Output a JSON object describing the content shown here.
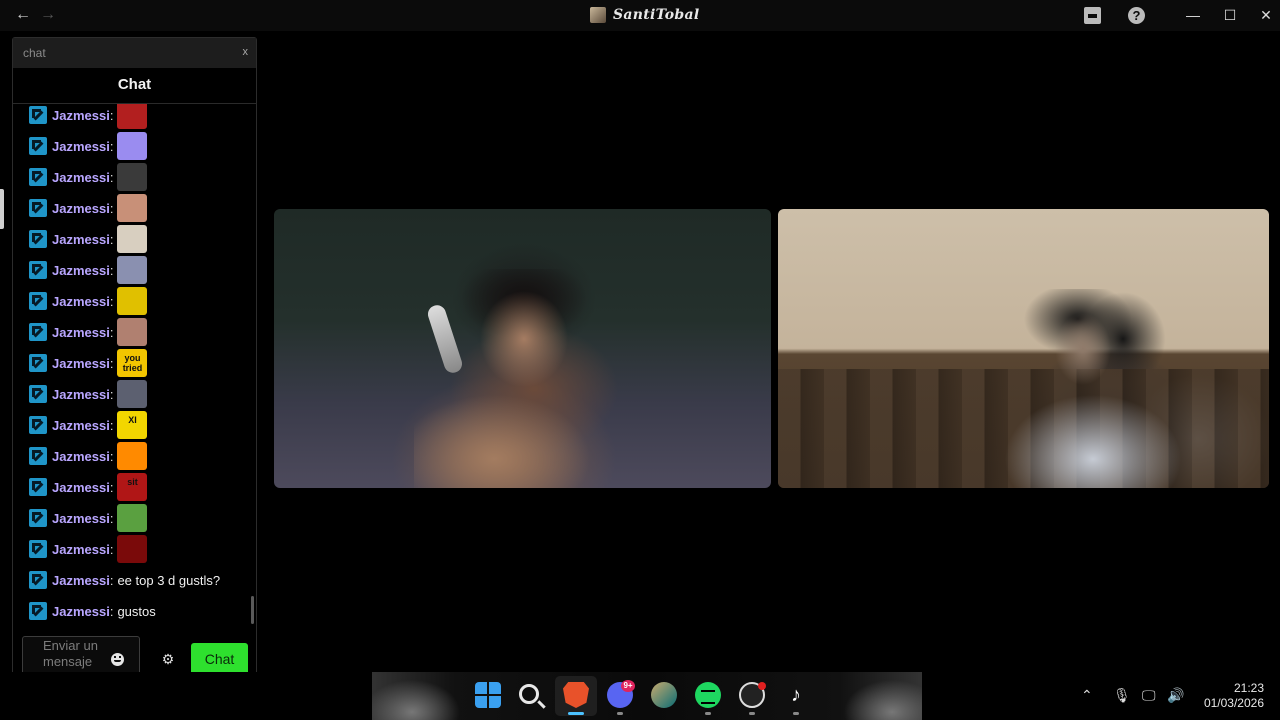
{
  "window": {
    "title": "SantiTobal",
    "back_icon": "arrow-left-icon",
    "forward_icon": "arrow-right-icon",
    "minimize": "—",
    "maximize": "☐",
    "close": "✕"
  },
  "chat": {
    "top_label": "chat",
    "close_label": "x",
    "header": "Chat",
    "messages": [
      {
        "user": "Jazmessi",
        "text": "",
        "emote_color": "#b21f1f"
      },
      {
        "user": "Jazmessi",
        "text": "",
        "emote_color": "#9a8cf0"
      },
      {
        "user": "Jazmessi",
        "text": "",
        "emote_color": "#3a3a3a"
      },
      {
        "user": "Jazmessi",
        "text": "",
        "emote_color": "#c89078"
      },
      {
        "user": "Jazmessi",
        "text": "",
        "emote_color": "#d8cfc0"
      },
      {
        "user": "Jazmessi",
        "text": "",
        "emote_color": "#8a90b0"
      },
      {
        "user": "Jazmessi",
        "text": "",
        "emote_color": "#e0c000"
      },
      {
        "user": "Jazmessi",
        "text": "",
        "emote_color": "#b08070"
      },
      {
        "user": "Jazmessi",
        "text": "",
        "emote_label": "you tried",
        "emote_color": "#f2c500"
      },
      {
        "user": "Jazmessi",
        "text": "",
        "emote_color": "#5c6070"
      },
      {
        "user": "Jazmessi",
        "text": "",
        "emote_label": "XI",
        "emote_color": "#f2d600"
      },
      {
        "user": "Jazmessi",
        "text": "",
        "emote_color": "#ff8a00"
      },
      {
        "user": "Jazmessi",
        "text": "",
        "emote_label": "sit",
        "emote_color": "#b01616"
      },
      {
        "user": "Jazmessi",
        "text": "",
        "emote_color": "#5aa040"
      },
      {
        "user": "Jazmessi",
        "text": "",
        "emote_color": "#7a0a0a"
      },
      {
        "user": "Jazmessi",
        "text": "ee top 3 d gustls?"
      },
      {
        "user": "Jazmessi",
        "text": "gustos"
      }
    ],
    "input_placeholder": "Enviar un mensaje",
    "send_label": "Chat"
  },
  "taskbar": {
    "apps": [
      "start-icon",
      "search-icon",
      "brave-icon",
      "discord-icon",
      "league-icon",
      "spotify-icon",
      "obs-icon",
      "tiktok-icon"
    ],
    "discord_badge": "9+",
    "time": "21:23",
    "date": "01/03/2026"
  },
  "colors": {
    "accent_send": "#2ee02e",
    "username": "#b9a6ff",
    "badge": "#1f95c8"
  }
}
